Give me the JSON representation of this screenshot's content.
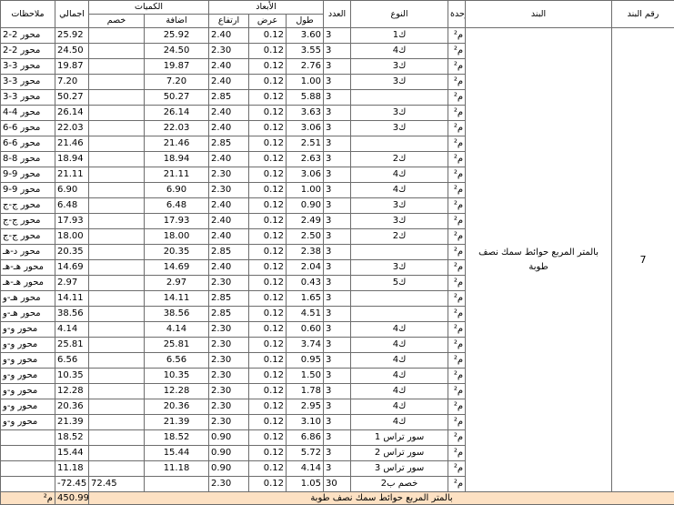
{
  "headers": {
    "item_no": "رقم البند",
    "description": "البند",
    "unit": "الوحدة",
    "type": "النوع",
    "count": "العدد",
    "dimensions": "الأبعاد",
    "length": "طول",
    "width": "عرض",
    "height": "ارتفاع",
    "quantities": "الكميات",
    "addition": "اضافة",
    "deduction": "خصم",
    "total": "اجمالي",
    "notes": "ملاحظات"
  },
  "item": {
    "number": "7",
    "description": "بالمتر المربع حوائط سمك نصف طوبة"
  },
  "rows": [
    {
      "unit": "م²",
      "type": "ك1",
      "count": "3",
      "length": "3.60",
      "width": "0.12",
      "height": "2.40",
      "add": "25.92",
      "ded": "",
      "total": "25.92",
      "note": "محور 2-2"
    },
    {
      "unit": "م²",
      "type": "ك4",
      "count": "3",
      "length": "3.55",
      "width": "0.12",
      "height": "2.30",
      "add": "24.50",
      "ded": "",
      "total": "24.50",
      "note": "محور 2-2"
    },
    {
      "unit": "م²",
      "type": "ك3",
      "count": "3",
      "length": "2.76",
      "width": "0.12",
      "height": "2.40",
      "add": "19.87",
      "ded": "",
      "total": "19.87",
      "note": "محور 3-3"
    },
    {
      "unit": "م²",
      "type": "ك3",
      "count": "3",
      "length": "1.00",
      "width": "0.12",
      "height": "2.40",
      "add": "7.20",
      "ded": "",
      "total": "7.20",
      "note": "محور 3-3"
    },
    {
      "unit": "م²",
      "type": "",
      "count": "3",
      "length": "5.88",
      "width": "0.12",
      "height": "2.85",
      "add": "50.27",
      "ded": "",
      "total": "50.27",
      "note": "محور 3-3"
    },
    {
      "unit": "م²",
      "type": "ك3",
      "count": "3",
      "length": "3.63",
      "width": "0.12",
      "height": "2.40",
      "add": "26.14",
      "ded": "",
      "total": "26.14",
      "note": "محور 4-4"
    },
    {
      "unit": "م²",
      "type": "ك3",
      "count": "3",
      "length": "3.06",
      "width": "0.12",
      "height": "2.40",
      "add": "22.03",
      "ded": "",
      "total": "22.03",
      "note": "محور 6-6"
    },
    {
      "unit": "م²",
      "type": "",
      "count": "3",
      "length": "2.51",
      "width": "0.12",
      "height": "2.85",
      "add": "21.46",
      "ded": "",
      "total": "21.46",
      "note": "محور 6-6"
    },
    {
      "unit": "م²",
      "type": "ك2",
      "count": "3",
      "length": "2.63",
      "width": "0.12",
      "height": "2.40",
      "add": "18.94",
      "ded": "",
      "total": "18.94",
      "note": "محور 8-8"
    },
    {
      "unit": "م²",
      "type": "ك4",
      "count": "3",
      "length": "3.06",
      "width": "0.12",
      "height": "2.30",
      "add": "21.11",
      "ded": "",
      "total": "21.11",
      "note": "محور 9-9"
    },
    {
      "unit": "م²",
      "type": "ك4",
      "count": "3",
      "length": "1.00",
      "width": "0.12",
      "height": "2.30",
      "add": "6.90",
      "ded": "",
      "total": "6.90",
      "note": "محور 9-9"
    },
    {
      "unit": "م²",
      "type": "ك3",
      "count": "3",
      "length": "0.90",
      "width": "0.12",
      "height": "2.40",
      "add": "6.48",
      "ded": "",
      "total": "6.48",
      "note": "محور ج-ج"
    },
    {
      "unit": "م²",
      "type": "ك3",
      "count": "3",
      "length": "2.49",
      "width": "0.12",
      "height": "2.40",
      "add": "17.93",
      "ded": "",
      "total": "17.93",
      "note": "محور ج-ج"
    },
    {
      "unit": "م²",
      "type": "ك2",
      "count": "3",
      "length": "2.50",
      "width": "0.12",
      "height": "2.40",
      "add": "18.00",
      "ded": "",
      "total": "18.00",
      "note": "محور ج-ج"
    },
    {
      "unit": "م²",
      "type": "",
      "count": "3",
      "length": "2.38",
      "width": "0.12",
      "height": "2.85",
      "add": "20.35",
      "ded": "",
      "total": "20.35",
      "note": "محور د-هـ"
    },
    {
      "unit": "م²",
      "type": "ك3",
      "count": "3",
      "length": "2.04",
      "width": "0.12",
      "height": "2.40",
      "add": "14.69",
      "ded": "",
      "total": "14.69",
      "note": "محور هـ-هـ"
    },
    {
      "unit": "م²",
      "type": "ك5",
      "count": "3",
      "length": "0.43",
      "width": "0.12",
      "height": "2.30",
      "add": "2.97",
      "ded": "",
      "total": "2.97",
      "note": "محور هـ-هـ"
    },
    {
      "unit": "م²",
      "type": "",
      "count": "3",
      "length": "1.65",
      "width": "0.12",
      "height": "2.85",
      "add": "14.11",
      "ded": "",
      "total": "14.11",
      "note": "محور هـ-و"
    },
    {
      "unit": "م²",
      "type": "",
      "count": "3",
      "length": "4.51",
      "width": "0.12",
      "height": "2.85",
      "add": "38.56",
      "ded": "",
      "total": "38.56",
      "note": "محور هـ-و"
    },
    {
      "unit": "م²",
      "type": "ك4",
      "count": "3",
      "length": "0.60",
      "width": "0.12",
      "height": "2.30",
      "add": "4.14",
      "ded": "",
      "total": "4.14",
      "note": "محور و-و"
    },
    {
      "unit": "م²",
      "type": "ك4",
      "count": "3",
      "length": "3.74",
      "width": "0.12",
      "height": "2.30",
      "add": "25.81",
      "ded": "",
      "total": "25.81",
      "note": "محور و-و"
    },
    {
      "unit": "م²",
      "type": "ك4",
      "count": "3",
      "length": "0.95",
      "width": "0.12",
      "height": "2.30",
      "add": "6.56",
      "ded": "",
      "total": "6.56",
      "note": "محور و-و"
    },
    {
      "unit": "م²",
      "type": "ك4",
      "count": "3",
      "length": "1.50",
      "width": "0.12",
      "height": "2.30",
      "add": "10.35",
      "ded": "",
      "total": "10.35",
      "note": "محور و-و"
    },
    {
      "unit": "م²",
      "type": "ك4",
      "count": "3",
      "length": "1.78",
      "width": "0.12",
      "height": "2.30",
      "add": "12.28",
      "ded": "",
      "total": "12.28",
      "note": "محور و-و"
    },
    {
      "unit": "م²",
      "type": "ك4",
      "count": "3",
      "length": "2.95",
      "width": "0.12",
      "height": "2.30",
      "add": "20.36",
      "ded": "",
      "total": "20.36",
      "note": "محور و-و"
    },
    {
      "unit": "م²",
      "type": "ك4",
      "count": "3",
      "length": "3.10",
      "width": "0.12",
      "height": "2.30",
      "add": "21.39",
      "ded": "",
      "total": "21.39",
      "note": "محور و-و"
    },
    {
      "unit": "م²",
      "type": "سور تراس 1",
      "count": "3",
      "length": "6.86",
      "width": "0.12",
      "height": "0.90",
      "add": "18.52",
      "ded": "",
      "total": "18.52",
      "note": ""
    },
    {
      "unit": "م²",
      "type": "سور تراس 2",
      "count": "3",
      "length": "5.72",
      "width": "0.12",
      "height": "0.90",
      "add": "15.44",
      "ded": "",
      "total": "15.44",
      "note": ""
    },
    {
      "unit": "م²",
      "type": "سور تراس 3",
      "count": "3",
      "length": "4.14",
      "width": "0.12",
      "height": "0.90",
      "add": "11.18",
      "ded": "",
      "total": "11.18",
      "note": ""
    },
    {
      "unit": "م²",
      "type": "خصم ب2",
      "count": "30",
      "length": "1.05",
      "width": "0.12",
      "height": "2.30",
      "add": "",
      "ded": "72.45",
      "total": "-72.45",
      "note": ""
    }
  ],
  "summary": {
    "unit": "م²",
    "total": "450.99",
    "description": "بالمتر المربع حوائط سمك نصف طوبة"
  }
}
